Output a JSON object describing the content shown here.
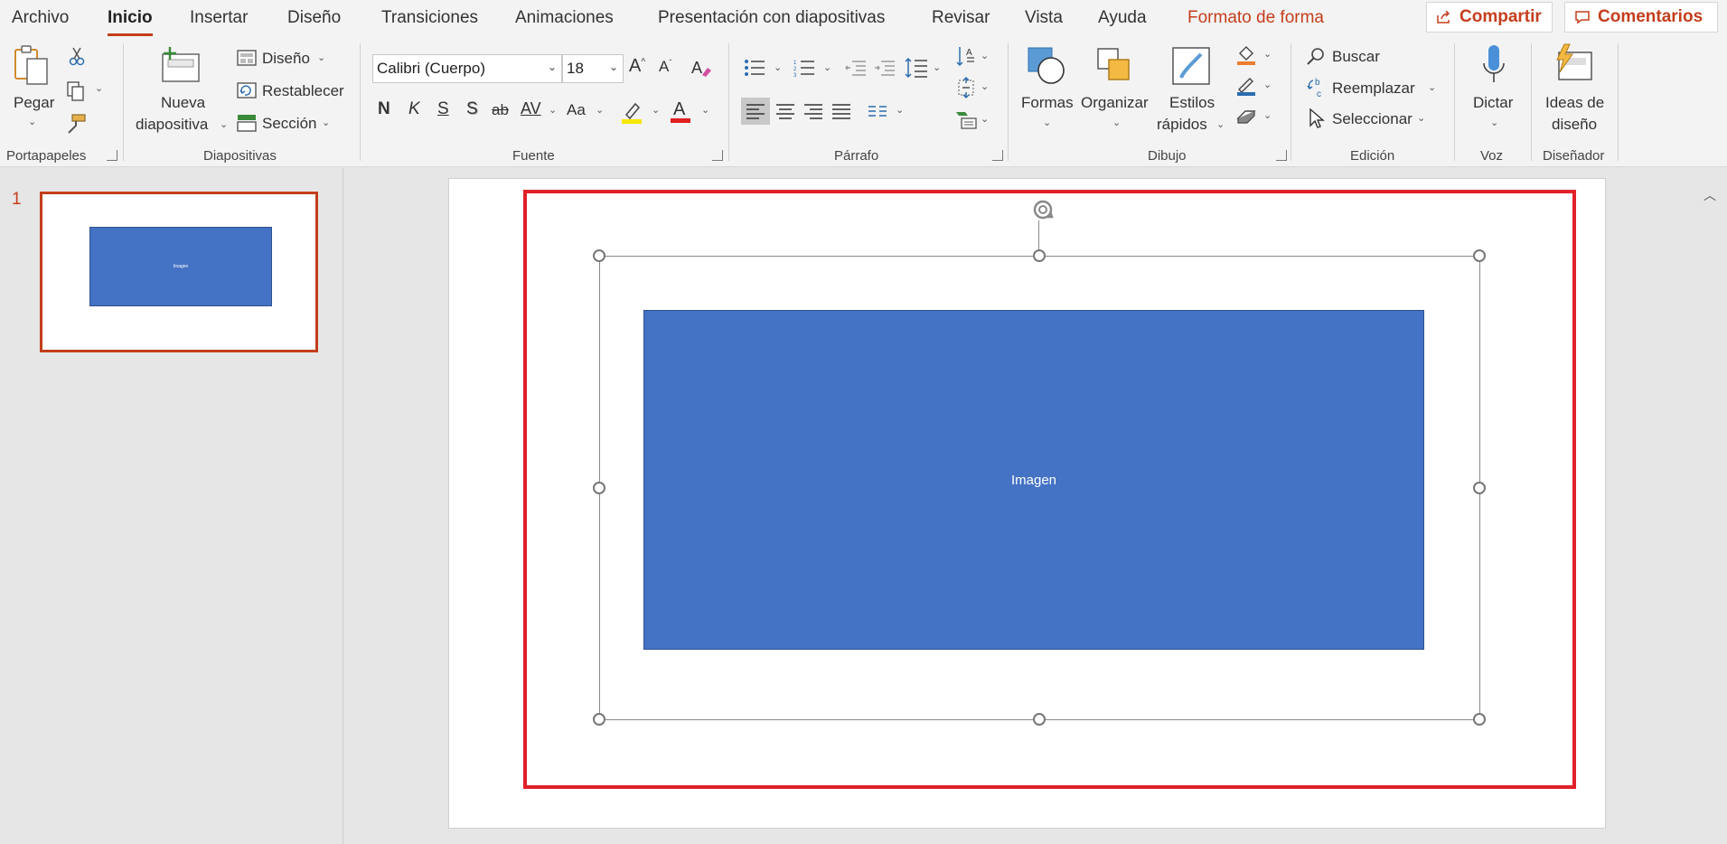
{
  "menu": {
    "tabs": [
      "Archivo",
      "Inicio",
      "Insertar",
      "Diseño",
      "Transiciones",
      "Animaciones",
      "Presentación con diapositivas",
      "Revisar",
      "Vista",
      "Ayuda",
      "Formato de forma"
    ],
    "share": "Compartir",
    "comments": "Comentarios"
  },
  "ribbon": {
    "clipboard": {
      "label": "Portapapeles",
      "paste": "Pegar"
    },
    "slides": {
      "label": "Diapositivas",
      "new_slide_1": "Nueva",
      "new_slide_2": "diapositiva",
      "layout": "Diseño",
      "reset": "Restablecer",
      "section": "Sección"
    },
    "font": {
      "label": "Fuente",
      "font_name": "Calibri (Cuerpo)",
      "font_size": "18",
      "bold": "N",
      "italic": "K",
      "underline": "S",
      "shadow": "S",
      "strike": "ab",
      "spacing": "AV",
      "case": "Aa"
    },
    "paragraph": {
      "label": "Párrafo"
    },
    "drawing": {
      "label": "Dibujo",
      "shapes": "Formas",
      "arrange": "Organizar",
      "quick_styles_1": "Estilos",
      "quick_styles_2": "rápidos"
    },
    "editing": {
      "label": "Edición",
      "find": "Buscar",
      "replace": "Reemplazar",
      "select": "Seleccionar"
    },
    "voice": {
      "label": "Voz",
      "dictate": "Dictar"
    },
    "designer": {
      "label": "Diseñador",
      "ideas_1": "Ideas de",
      "ideas_2": "diseño"
    }
  },
  "thumbnails": {
    "slide_number": "1",
    "shape_text": "Imagen"
  },
  "slide": {
    "shape_text": "Imagen"
  },
  "colors": {
    "accent": "#c43e1c",
    "shape_fill": "#4472c4",
    "highlight_frame": "#e0202a"
  }
}
